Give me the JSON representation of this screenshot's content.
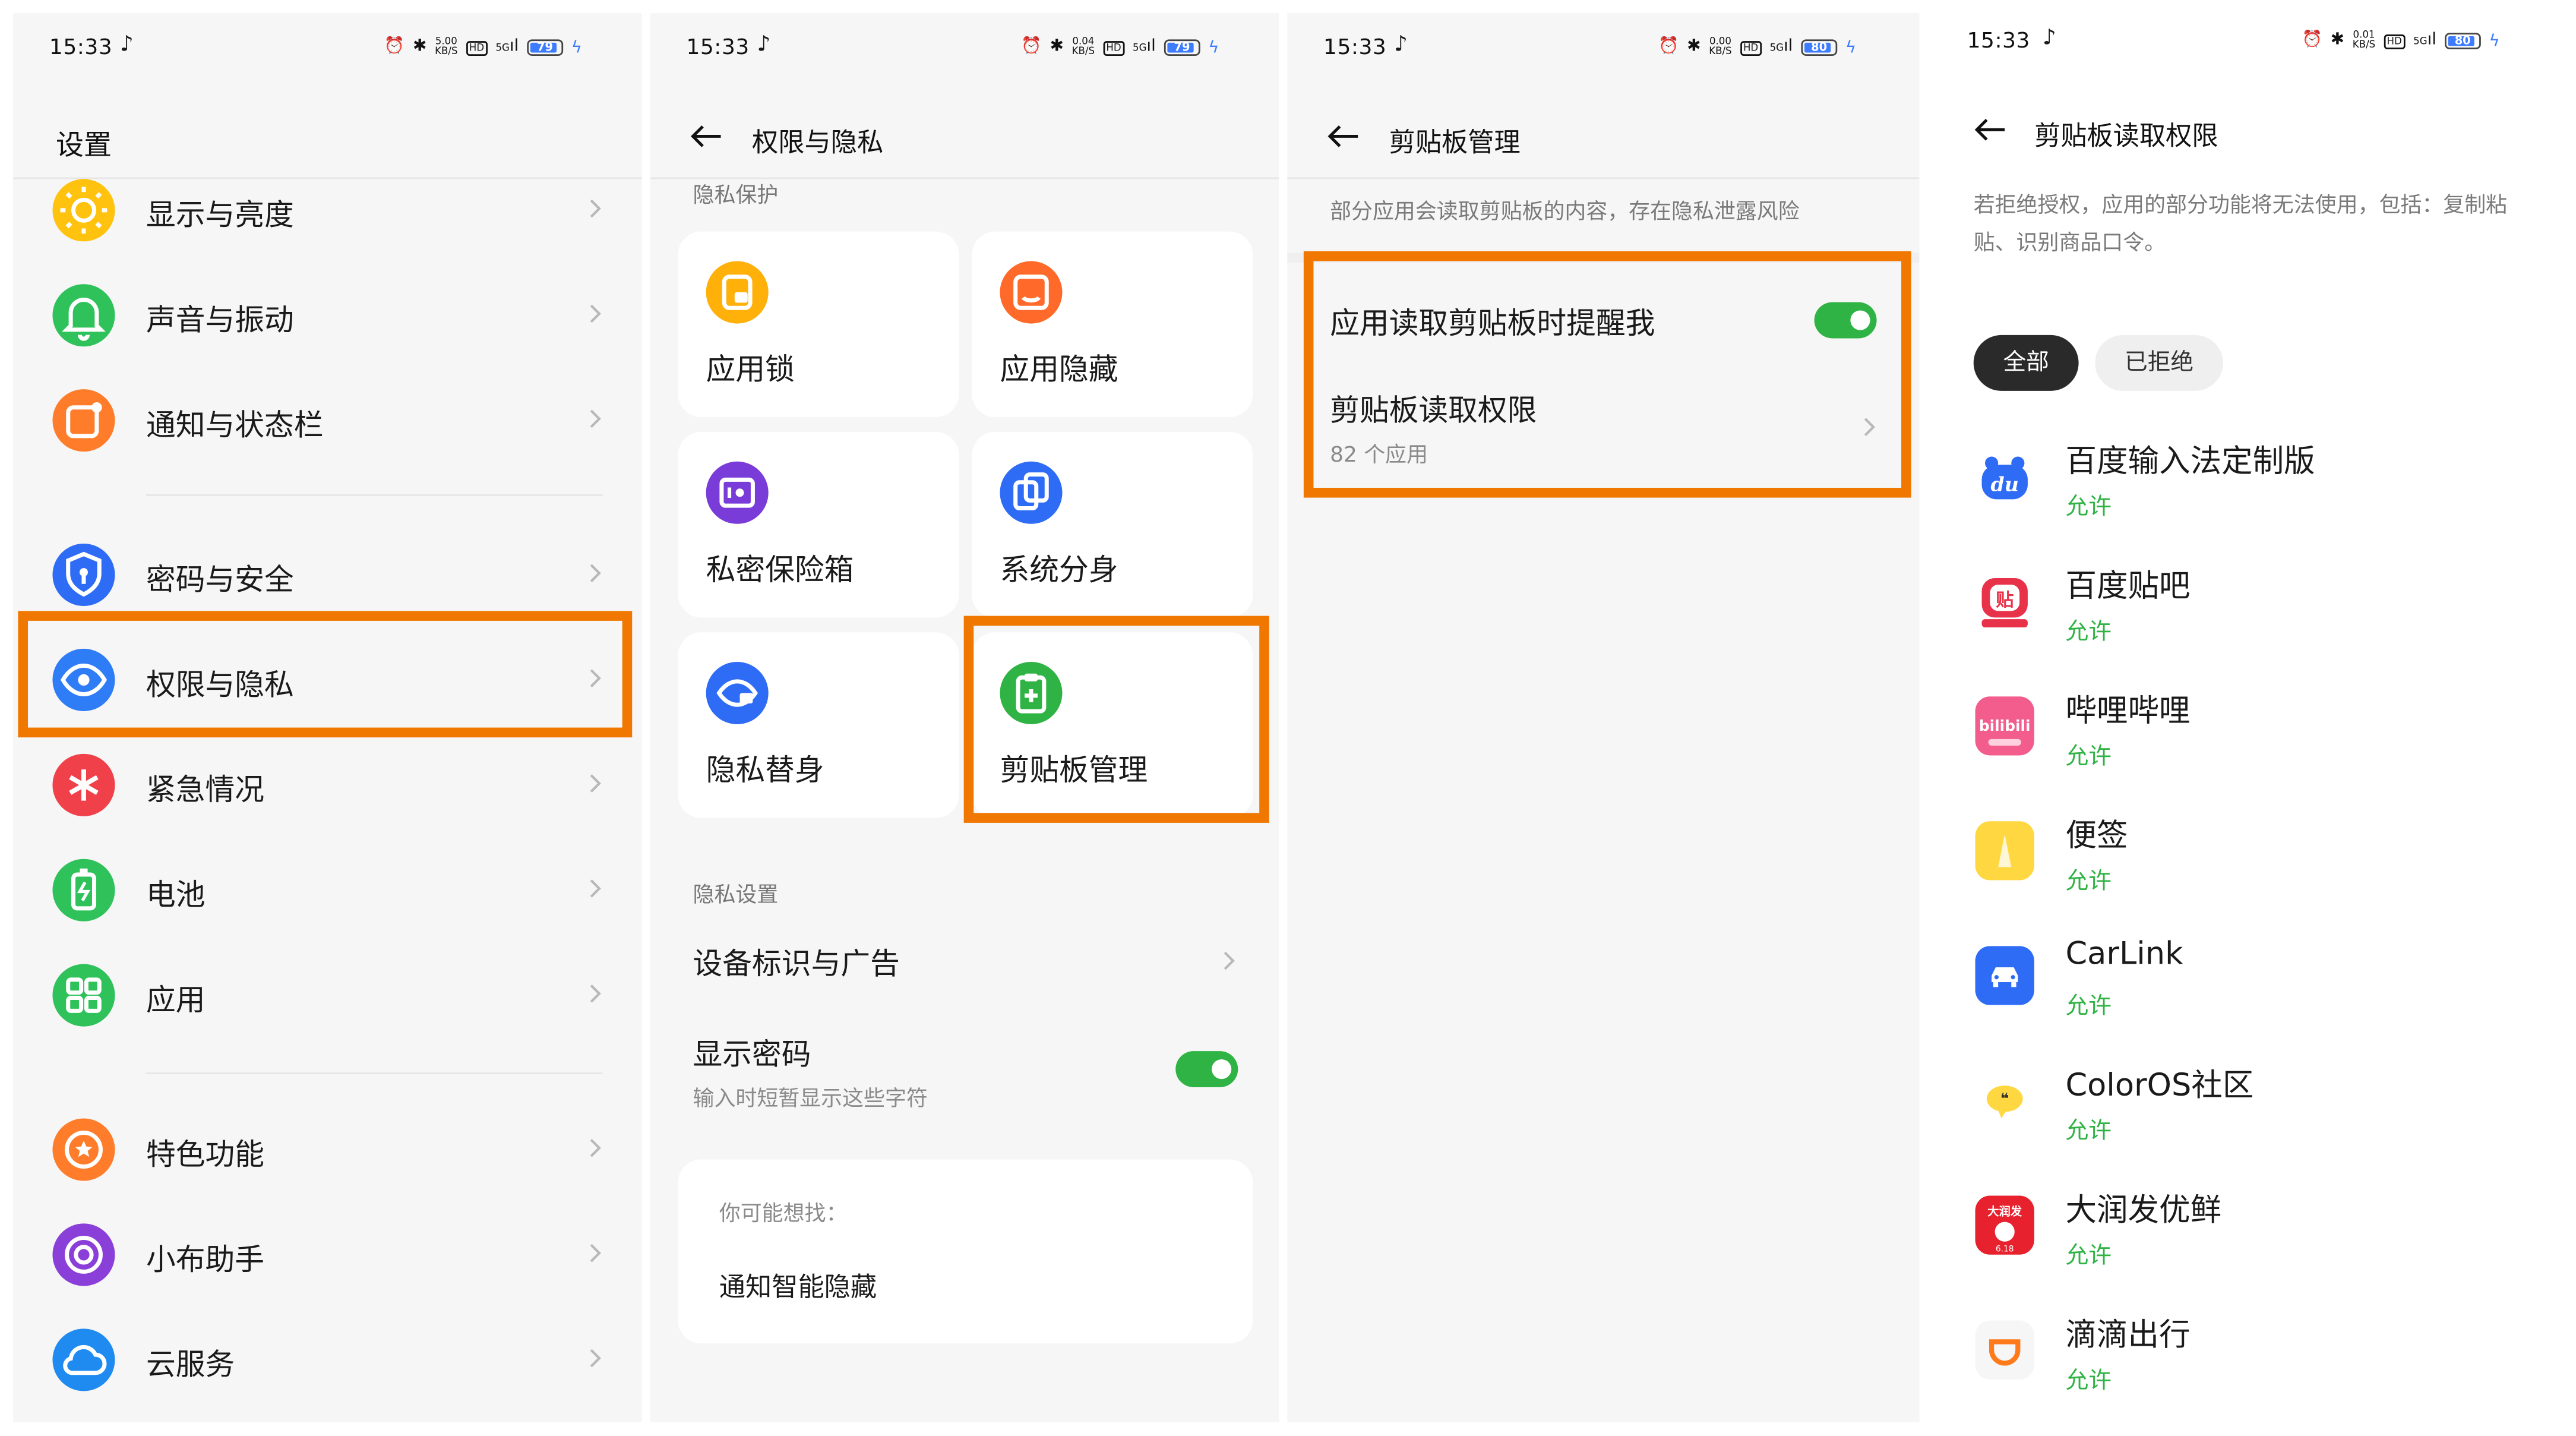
{
  "status": {
    "time": "15:33",
    "speeds": [
      "5.00",
      "0.04",
      "0.00",
      "0.01"
    ],
    "speed_unit": "KB/S",
    "hd": "HD",
    "signal": "5G",
    "battery": [
      "79",
      "79",
      "80",
      "80"
    ]
  },
  "panel1": {
    "title": "设置",
    "items": [
      {
        "label": "显示与亮度",
        "icon": "sun-icon",
        "color": "#ffc20e"
      },
      {
        "label": "声音与振动",
        "icon": "bell-icon",
        "color": "#2fc25b"
      },
      {
        "label": "通知与状态栏",
        "icon": "notification-icon",
        "color": "#ff7d2a"
      },
      {
        "label": "密码与安全",
        "icon": "shield-icon",
        "color": "#2e6cf6"
      },
      {
        "label": "权限与隐私",
        "icon": "privacy-eye-icon",
        "color": "#2e7cf6"
      },
      {
        "label": "紧急情况",
        "icon": "emergency-icon",
        "color": "#f0404a"
      },
      {
        "label": "电池",
        "icon": "battery-icon",
        "color": "#2fc25b"
      },
      {
        "label": "应用",
        "icon": "apps-grid-icon",
        "color": "#2fc25b"
      },
      {
        "label": "特色功能",
        "icon": "star-icon",
        "color": "#ff7d2a"
      },
      {
        "label": "小布助手",
        "icon": "assistant-icon",
        "color": "#8b3fd9"
      },
      {
        "label": "云服务",
        "icon": "cloud-icon",
        "color": "#1f8bf0"
      }
    ]
  },
  "panel2": {
    "title": "权限与隐私",
    "section_protect": "隐私保护",
    "cards": [
      {
        "label": "应用锁",
        "icon": "app-lock-icon",
        "color": "#ffb10a"
      },
      {
        "label": "应用隐藏",
        "icon": "app-hide-icon",
        "color": "#ff6a2a"
      },
      {
        "label": "私密保险箱",
        "icon": "safe-box-icon",
        "color": "#7a3cd9"
      },
      {
        "label": "系统分身",
        "icon": "clone-icon",
        "color": "#2e6cf6"
      },
      {
        "label": "隐私替身",
        "icon": "privacy-substitute-icon",
        "color": "#2e6cf6"
      },
      {
        "label": "剪贴板管理",
        "icon": "clipboard-icon",
        "color": "#2fb344"
      }
    ],
    "section_settings": "隐私设置",
    "device_id": "设备标识与广告",
    "show_password": "显示密码",
    "show_password_sub": "输入时短暂显示这些字符",
    "suggest_title": "你可能想找：",
    "suggest_item": "通知智能隐藏"
  },
  "panel3": {
    "title": "剪贴板管理",
    "desc": "部分应用会读取剪贴板的内容，存在隐私泄露风险",
    "remind": "应用读取剪贴板时提醒我",
    "perm": "剪贴板读取权限",
    "perm_sub": "82 个应用"
  },
  "panel4": {
    "title": "剪贴板读取权限",
    "desc": "若拒绝授权，应用的部分功能将无法使用，包括：复制粘贴、识别商品口令。",
    "chip_all": "全部",
    "chip_denied": "已拒绝",
    "apps": [
      {
        "name": "百度输入法定制版",
        "status": "允许",
        "icon": "baidu-input-icon",
        "mark": "du"
      },
      {
        "name": "百度贴吧",
        "status": "允许",
        "icon": "tieba-icon",
        "mark": "贴"
      },
      {
        "name": "哔哩哔哩",
        "status": "允许",
        "icon": "bilibili-icon",
        "mark": "bilibili"
      },
      {
        "name": "便签",
        "status": "允许",
        "icon": "notes-icon",
        "mark": ""
      },
      {
        "name": "CarLink",
        "status": "允许",
        "icon": "carlink-icon",
        "mark": ""
      },
      {
        "name": "ColorOS社区",
        "status": "允许",
        "icon": "coloros-community-icon",
        "mark": ""
      },
      {
        "name": "大润发优鲜",
        "status": "允许",
        "icon": "rt-mart-icon",
        "mark": "大润发"
      },
      {
        "name": "滴滴出行",
        "status": "允许",
        "icon": "didi-icon",
        "mark": ""
      }
    ]
  }
}
